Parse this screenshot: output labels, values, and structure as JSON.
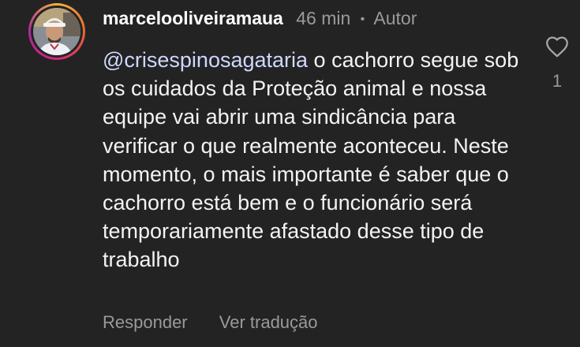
{
  "comment": {
    "username": "marcelooliveiramaua",
    "time": "46 min",
    "role": "Autor",
    "mention": "@crisespinosagataria",
    "text": " o cachorro segue sob os cuidados da Proteção animal e nossa equipe vai abrir uma sindicância para verificar o que realmente aconteceu. Neste momento, o mais importante é saber que o cachorro está bem e o funcionário será temporariamente afastado desse tipo de trabalho",
    "reply_label": "Responder",
    "translate_label": "Ver tradução",
    "like_count": "1"
  },
  "colors": {
    "background": "#232323",
    "text": "#f3f3f3",
    "secondary": "#9a9a9a",
    "mention": "#cfd8ff"
  },
  "icons": {
    "like": "heart-outline-icon",
    "avatar": "profile-photo"
  }
}
